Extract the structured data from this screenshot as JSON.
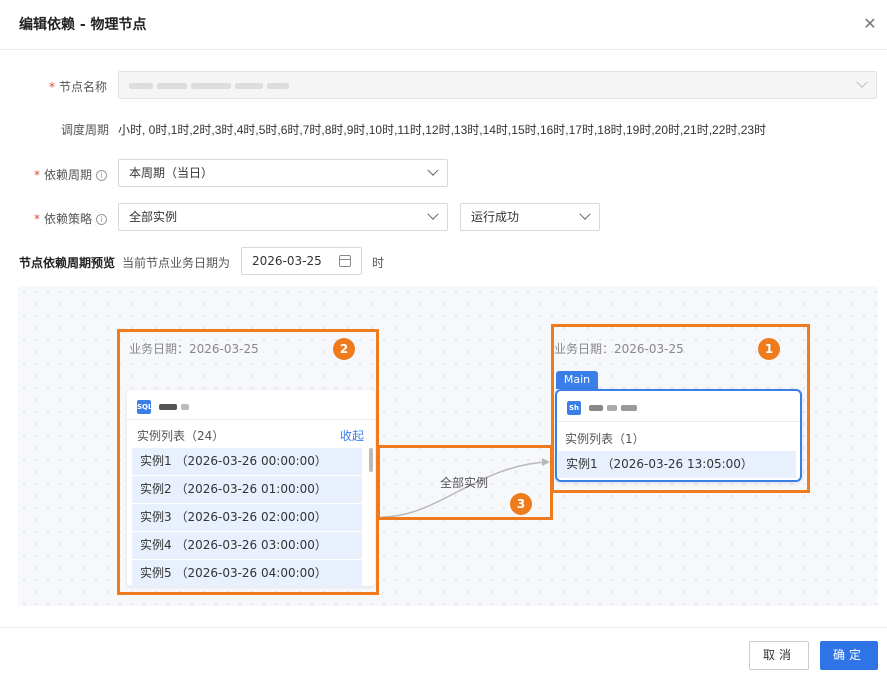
{
  "dialog": {
    "title": "编辑依赖 - 物理节点",
    "close_icon": "close-icon"
  },
  "form": {
    "node_name": {
      "label": "节点名称",
      "value": ""
    },
    "schedule_period": {
      "label": "调度周期",
      "value": "小时, 0时,1时,2时,3时,4时,5时,6时,7时,8时,9时,10时,11时,12时,13时,14时,15时,16时,17时,18时,19时,20时,21时,22时,23时"
    },
    "dependency_period": {
      "label": "依赖周期",
      "value": "本周期（当日）"
    },
    "dependency_strategy": {
      "label": "依赖策略",
      "value": "全部实例",
      "status_value": "运行成功"
    }
  },
  "preview": {
    "title": "节点依赖周期预览",
    "subtitle": "当前节点业务日期为",
    "date": "2026-03-25",
    "suffix": "时",
    "upstream": {
      "badge": "2",
      "biz_date": "业务日期：2026-03-25",
      "type": "SQL",
      "list_header": "实例列表（24）",
      "collapse": "收起",
      "rows": [
        "实例1  （2026-03-26 00:00:00）",
        "实例2  （2026-03-26 01:00:00）",
        "实例3  （2026-03-26 02:00:00）",
        "实例4  （2026-03-26 03:00:00）",
        "实例5  （2026-03-26 04:00:00）"
      ]
    },
    "edge": {
      "badge": "3",
      "label": "全部实例"
    },
    "current": {
      "badge": "1",
      "biz_date": "业务日期：2026-03-25",
      "tag": "Main",
      "type": "Sh",
      "list_header": "实例列表（1）",
      "rows": [
        "实例1  （2026-03-26 13:05:00）"
      ]
    }
  },
  "footer": {
    "cancel": "取消",
    "ok": "确定"
  },
  "colors": {
    "accent": "#2f74e6",
    "highlight": "#f07b1d",
    "required": "#e5483b"
  }
}
